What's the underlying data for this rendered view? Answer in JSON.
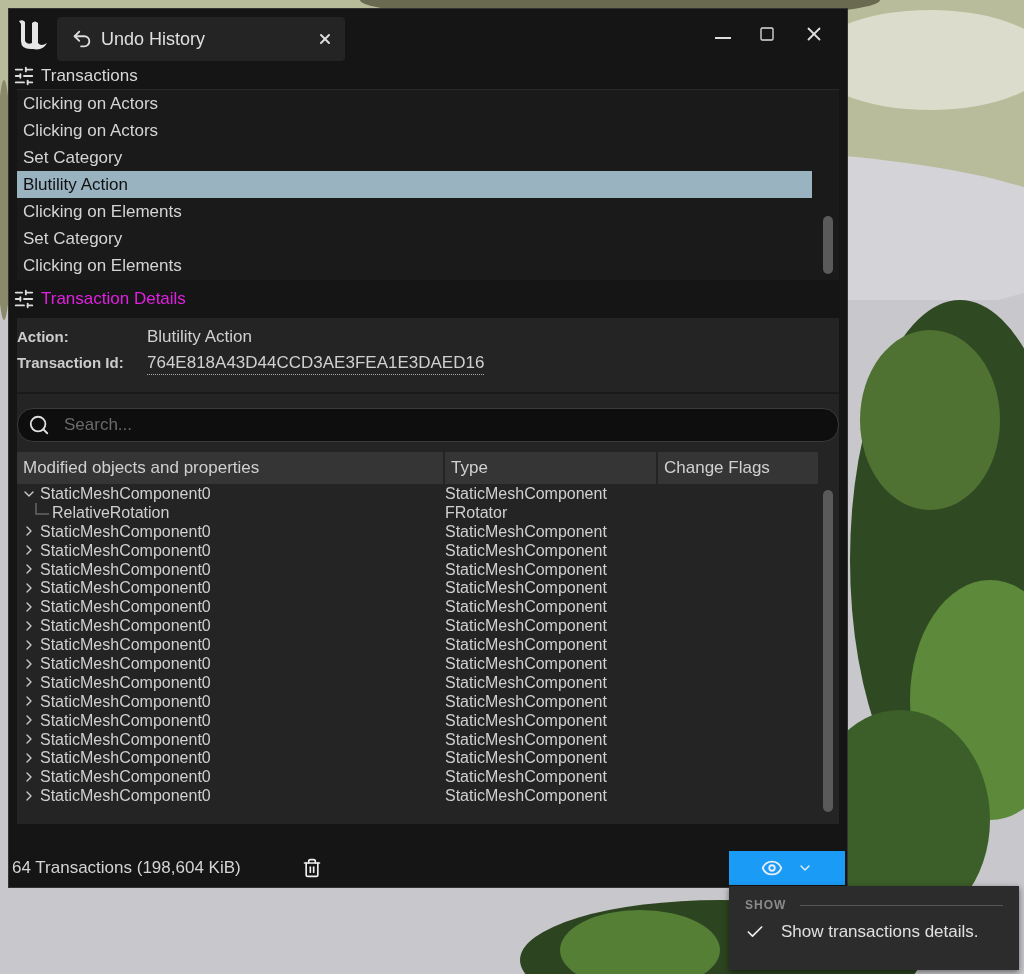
{
  "window": {
    "tab_title": "Undo History"
  },
  "transactions": {
    "title": "Transactions",
    "items": [
      {
        "label": "Clicking on Actors",
        "selected": false
      },
      {
        "label": "Clicking on Actors",
        "selected": false
      },
      {
        "label": "Set Category",
        "selected": false
      },
      {
        "label": "Blutility Action",
        "selected": true
      },
      {
        "label": "Clicking on Elements",
        "selected": false
      },
      {
        "label": "Set Category",
        "selected": false
      },
      {
        "label": "Clicking on Elements",
        "selected": false
      }
    ]
  },
  "details": {
    "title": "Transaction Details",
    "fields": [
      {
        "label": "Action:",
        "value": "Blutility Action",
        "kind": "text"
      },
      {
        "label": "Transaction Id:",
        "value": "764E818A43D44CCD3AE3FEA1E3DAED16",
        "kind": "id"
      }
    ]
  },
  "search": {
    "placeholder": "Search..."
  },
  "table": {
    "columns": [
      "Modified objects and properties",
      "Type",
      "Change Flags"
    ],
    "rows": [
      {
        "name": "StaticMeshComponent0",
        "type": "StaticMeshComponent",
        "expanded": true,
        "children": [
          {
            "name": "RelativeRotation",
            "type": "FRotator"
          }
        ]
      },
      {
        "name": "StaticMeshComponent0",
        "type": "StaticMeshComponent",
        "expanded": false
      },
      {
        "name": "StaticMeshComponent0",
        "type": "StaticMeshComponent",
        "expanded": false
      },
      {
        "name": "StaticMeshComponent0",
        "type": "StaticMeshComponent",
        "expanded": false
      },
      {
        "name": "StaticMeshComponent0",
        "type": "StaticMeshComponent",
        "expanded": false
      },
      {
        "name": "StaticMeshComponent0",
        "type": "StaticMeshComponent",
        "expanded": false
      },
      {
        "name": "StaticMeshComponent0",
        "type": "StaticMeshComponent",
        "expanded": false
      },
      {
        "name": "StaticMeshComponent0",
        "type": "StaticMeshComponent",
        "expanded": false
      },
      {
        "name": "StaticMeshComponent0",
        "type": "StaticMeshComponent",
        "expanded": false
      },
      {
        "name": "StaticMeshComponent0",
        "type": "StaticMeshComponent",
        "expanded": false
      },
      {
        "name": "StaticMeshComponent0",
        "type": "StaticMeshComponent",
        "expanded": false
      },
      {
        "name": "StaticMeshComponent0",
        "type": "StaticMeshComponent",
        "expanded": false
      },
      {
        "name": "StaticMeshComponent0",
        "type": "StaticMeshComponent",
        "expanded": false
      },
      {
        "name": "StaticMeshComponent0",
        "type": "StaticMeshComponent",
        "expanded": false
      },
      {
        "name": "StaticMeshComponent0",
        "type": "StaticMeshComponent",
        "expanded": false
      },
      {
        "name": "StaticMeshComponent0",
        "type": "StaticMeshComponent",
        "expanded": false
      }
    ]
  },
  "status_bar": {
    "summary": "64 Transactions (198,604 KiB)"
  },
  "view_menu": {
    "section": "SHOW",
    "items": [
      {
        "label": "Show transactions details.",
        "checked": true
      }
    ]
  }
}
